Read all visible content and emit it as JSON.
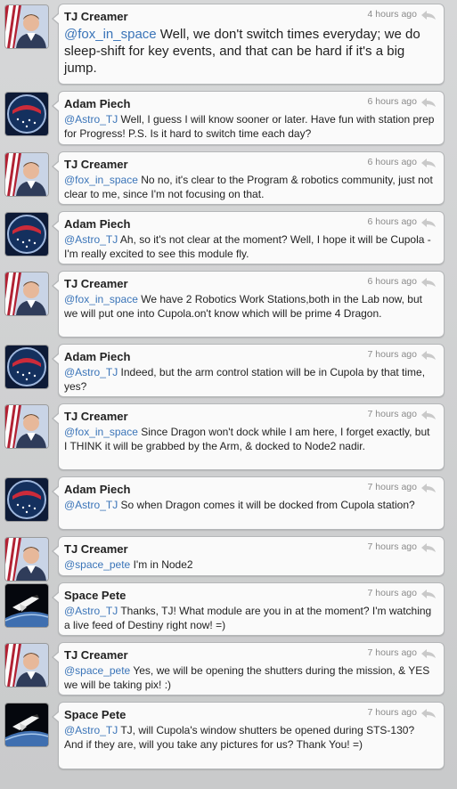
{
  "tweets": [
    {
      "author": "TJ Creamer",
      "avatar": "astronaut-avatar",
      "time": "4 hours ago",
      "mention": "@fox_in_space",
      "text": " Well, we don't switch times everyday; we do sleep-shift for key events, and that can be hard if it's a big jump."
    },
    {
      "author": "Adam Piech",
      "avatar": "mission-patch-avatar",
      "time": "6 hours ago",
      "mention": "@Astro_TJ",
      "text": " Well, I guess I will know sooner or later. Have fun with station prep for Progress! P.S. Is it hard to switch time each day?"
    },
    {
      "author": "TJ Creamer",
      "avatar": "astronaut-avatar",
      "time": "6 hours ago",
      "mention": "@fox_in_space",
      "text": " No no, it's clear to the Program & robotics community, just not clear to me, since I'm not focusing on that."
    },
    {
      "author": "Adam Piech",
      "avatar": "mission-patch-avatar",
      "time": "6 hours ago",
      "mention": "@Astro_TJ",
      "text": " Ah, so it's not clear at the moment? Well, I hope it will be Cupola - I'm really excited to see this module fly."
    },
    {
      "author": "TJ Creamer",
      "avatar": "astronaut-avatar",
      "time": "6 hours ago",
      "mention": "@fox_in_space",
      "text": " We have 2 Robotics Work Stations,both in the Lab now, but we will put one into Cupola.on't know which will be prime 4 Dragon."
    },
    {
      "author": "Adam Piech",
      "avatar": "mission-patch-avatar",
      "time": "7 hours ago",
      "mention": "@Astro_TJ",
      "text": " Indeed, but the arm control station will be in Cupola by that time, yes?"
    },
    {
      "author": "TJ Creamer",
      "avatar": "astronaut-avatar",
      "time": "7 hours ago",
      "mention": "@fox_in_space",
      "text": " Since Dragon won't dock while I am here, I forget exactly, but I THINK it will be grabbed by the Arm, & docked to Node2 nadir."
    },
    {
      "author": "Adam Piech",
      "avatar": "mission-patch-avatar",
      "time": "7 hours ago",
      "mention": "@Astro_TJ",
      "text": " So when Dragon comes it will be docked from Cupola station?"
    },
    {
      "author": "TJ Creamer",
      "avatar": "astronaut-avatar",
      "time": "7 hours ago",
      "mention": "@space_pete",
      "text": " I'm in Node2"
    },
    {
      "author": "Space Pete",
      "avatar": "shuttle-avatar",
      "time": "7 hours ago",
      "mention": "@Astro_TJ",
      "text": " Thanks, TJ! What module are you in at the moment? I'm watching a live feed of Destiny right now! =)"
    },
    {
      "author": "TJ Creamer",
      "avatar": "astronaut-avatar",
      "time": "7 hours ago",
      "mention": "@space_pete",
      "text": " Yes, we will be opening the shutters during the mission, & YES we will be taking pix! :)"
    },
    {
      "author": "Space Pete",
      "avatar": "shuttle-avatar",
      "time": "7 hours ago",
      "mention": "@Astro_TJ",
      "text": " TJ, will Cupola's window shutters be opened during STS-130? And if they are, will you take any pictures for us? Thank You! =)"
    }
  ]
}
